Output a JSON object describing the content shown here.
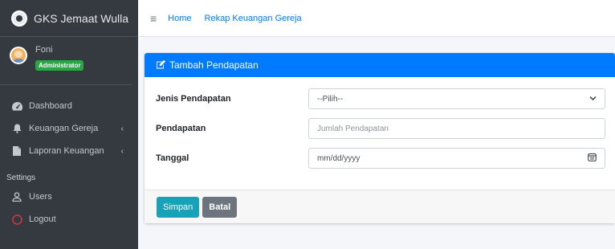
{
  "brand": {
    "title": "GKS Jemaat Wulla",
    "logo_icon": "church-logo-icon"
  },
  "user": {
    "name": "Foni",
    "role": "Administrator"
  },
  "sidebar": {
    "items": [
      {
        "label": "Dashboard",
        "icon": "dashboard-icon"
      },
      {
        "label": "Keuangan Gereja",
        "icon": "bell-icon",
        "caret": "‹"
      },
      {
        "label": "Laporan Keuangan",
        "icon": "file-icon",
        "caret": "‹"
      }
    ],
    "settings_header": "Settings",
    "settings_items": [
      {
        "label": "Users",
        "icon": "user-icon"
      },
      {
        "label": "Logout",
        "icon": "power-icon",
        "color": "#dc3545"
      }
    ]
  },
  "topbar": {
    "menu_icon": "≡",
    "home": "Home",
    "page": "Rekap Keuangan Gereja"
  },
  "card": {
    "title": "Tambah Pendapatan",
    "fields": {
      "jenis": {
        "label": "Jenis Pendapatan",
        "value": "--Pilih--",
        "caret": "⌄"
      },
      "pendapatan": {
        "label": "Pendapatan",
        "placeholder": "Jumlah Pendapatan"
      },
      "tanggal": {
        "label": "Tanggal",
        "placeholder": "mm/dd/yyyy"
      }
    },
    "buttons": {
      "save": "Simpan",
      "cancel": "Batal"
    }
  },
  "colors": {
    "primary": "#007bff",
    "sidebar": "#343a40",
    "success": "#28a745",
    "info": "#17a2b8",
    "secondary": "#6c757d"
  }
}
